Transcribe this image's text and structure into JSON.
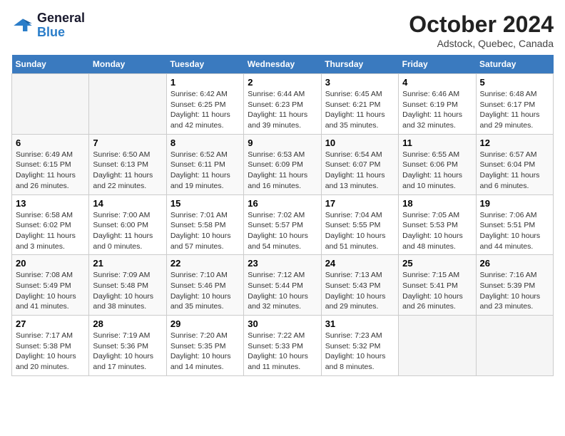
{
  "header": {
    "logo_line1": "General",
    "logo_line2": "Blue",
    "month_title": "October 2024",
    "location": "Adstock, Quebec, Canada"
  },
  "weekdays": [
    "Sunday",
    "Monday",
    "Tuesday",
    "Wednesday",
    "Thursday",
    "Friday",
    "Saturday"
  ],
  "weeks": [
    [
      {
        "day": "",
        "empty": true
      },
      {
        "day": "",
        "empty": true
      },
      {
        "day": "1",
        "sunrise": "6:42 AM",
        "sunset": "6:25 PM",
        "daylight": "11 hours and 42 minutes."
      },
      {
        "day": "2",
        "sunrise": "6:44 AM",
        "sunset": "6:23 PM",
        "daylight": "11 hours and 39 minutes."
      },
      {
        "day": "3",
        "sunrise": "6:45 AM",
        "sunset": "6:21 PM",
        "daylight": "11 hours and 35 minutes."
      },
      {
        "day": "4",
        "sunrise": "6:46 AM",
        "sunset": "6:19 PM",
        "daylight": "11 hours and 32 minutes."
      },
      {
        "day": "5",
        "sunrise": "6:48 AM",
        "sunset": "6:17 PM",
        "daylight": "11 hours and 29 minutes."
      }
    ],
    [
      {
        "day": "6",
        "sunrise": "6:49 AM",
        "sunset": "6:15 PM",
        "daylight": "11 hours and 26 minutes."
      },
      {
        "day": "7",
        "sunrise": "6:50 AM",
        "sunset": "6:13 PM",
        "daylight": "11 hours and 22 minutes."
      },
      {
        "day": "8",
        "sunrise": "6:52 AM",
        "sunset": "6:11 PM",
        "daylight": "11 hours and 19 minutes."
      },
      {
        "day": "9",
        "sunrise": "6:53 AM",
        "sunset": "6:09 PM",
        "daylight": "11 hours and 16 minutes."
      },
      {
        "day": "10",
        "sunrise": "6:54 AM",
        "sunset": "6:07 PM",
        "daylight": "11 hours and 13 minutes."
      },
      {
        "day": "11",
        "sunrise": "6:55 AM",
        "sunset": "6:06 PM",
        "daylight": "11 hours and 10 minutes."
      },
      {
        "day": "12",
        "sunrise": "6:57 AM",
        "sunset": "6:04 PM",
        "daylight": "11 hours and 6 minutes."
      }
    ],
    [
      {
        "day": "13",
        "sunrise": "6:58 AM",
        "sunset": "6:02 PM",
        "daylight": "11 hours and 3 minutes."
      },
      {
        "day": "14",
        "sunrise": "7:00 AM",
        "sunset": "6:00 PM",
        "daylight": "11 hours and 0 minutes."
      },
      {
        "day": "15",
        "sunrise": "7:01 AM",
        "sunset": "5:58 PM",
        "daylight": "10 hours and 57 minutes."
      },
      {
        "day": "16",
        "sunrise": "7:02 AM",
        "sunset": "5:57 PM",
        "daylight": "10 hours and 54 minutes."
      },
      {
        "day": "17",
        "sunrise": "7:04 AM",
        "sunset": "5:55 PM",
        "daylight": "10 hours and 51 minutes."
      },
      {
        "day": "18",
        "sunrise": "7:05 AM",
        "sunset": "5:53 PM",
        "daylight": "10 hours and 48 minutes."
      },
      {
        "day": "19",
        "sunrise": "7:06 AM",
        "sunset": "5:51 PM",
        "daylight": "10 hours and 44 minutes."
      }
    ],
    [
      {
        "day": "20",
        "sunrise": "7:08 AM",
        "sunset": "5:49 PM",
        "daylight": "10 hours and 41 minutes."
      },
      {
        "day": "21",
        "sunrise": "7:09 AM",
        "sunset": "5:48 PM",
        "daylight": "10 hours and 38 minutes."
      },
      {
        "day": "22",
        "sunrise": "7:10 AM",
        "sunset": "5:46 PM",
        "daylight": "10 hours and 35 minutes."
      },
      {
        "day": "23",
        "sunrise": "7:12 AM",
        "sunset": "5:44 PM",
        "daylight": "10 hours and 32 minutes."
      },
      {
        "day": "24",
        "sunrise": "7:13 AM",
        "sunset": "5:43 PM",
        "daylight": "10 hours and 29 minutes."
      },
      {
        "day": "25",
        "sunrise": "7:15 AM",
        "sunset": "5:41 PM",
        "daylight": "10 hours and 26 minutes."
      },
      {
        "day": "26",
        "sunrise": "7:16 AM",
        "sunset": "5:39 PM",
        "daylight": "10 hours and 23 minutes."
      }
    ],
    [
      {
        "day": "27",
        "sunrise": "7:17 AM",
        "sunset": "5:38 PM",
        "daylight": "10 hours and 20 minutes."
      },
      {
        "day": "28",
        "sunrise": "7:19 AM",
        "sunset": "5:36 PM",
        "daylight": "10 hours and 17 minutes."
      },
      {
        "day": "29",
        "sunrise": "7:20 AM",
        "sunset": "5:35 PM",
        "daylight": "10 hours and 14 minutes."
      },
      {
        "day": "30",
        "sunrise": "7:22 AM",
        "sunset": "5:33 PM",
        "daylight": "10 hours and 11 minutes."
      },
      {
        "day": "31",
        "sunrise": "7:23 AM",
        "sunset": "5:32 PM",
        "daylight": "10 hours and 8 minutes."
      },
      {
        "day": "",
        "empty": true
      },
      {
        "day": "",
        "empty": true
      }
    ]
  ]
}
